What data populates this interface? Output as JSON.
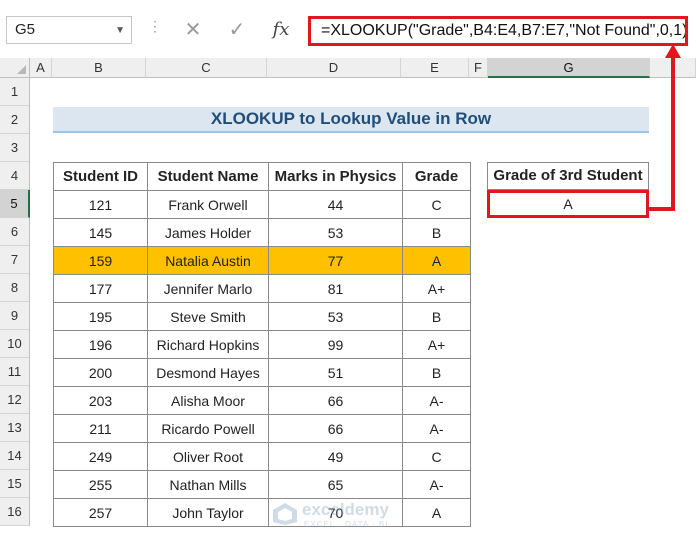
{
  "name_box": {
    "value": "G5"
  },
  "formula_bar": {
    "separator": "⋮",
    "cancel_symbol": "✕",
    "enter_symbol": "✓",
    "fx_label": "fx",
    "formula": "=XLOOKUP(\"Grade\",B4:E4,B7:E7,\"Not Found\",0,1)"
  },
  "columns": [
    "A",
    "B",
    "C",
    "D",
    "E",
    "F",
    "G"
  ],
  "selected_column": "G",
  "rows": [
    "1",
    "2",
    "3",
    "4",
    "5",
    "6",
    "7",
    "8",
    "9",
    "10",
    "11",
    "12",
    "13",
    "14",
    "15",
    "16"
  ],
  "selected_row": "5",
  "title": "XLOOKUP to Lookup Value in Row",
  "table": {
    "headers": [
      "Student ID",
      "Student Name",
      "Marks in Physics",
      "Grade"
    ],
    "highlight_row_index": 2,
    "rows": [
      [
        "121",
        "Frank Orwell",
        "44",
        "C"
      ],
      [
        "145",
        "James Holder",
        "53",
        "B"
      ],
      [
        "159",
        "Natalia Austin",
        "77",
        "A"
      ],
      [
        "177",
        "Jennifer Marlo",
        "81",
        "A+"
      ],
      [
        "195",
        "Steve Smith",
        "53",
        "B"
      ],
      [
        "196",
        "Richard Hopkins",
        "99",
        "A+"
      ],
      [
        "200",
        "Desmond Hayes",
        "51",
        "B"
      ],
      [
        "203",
        "Alisha Moor",
        "66",
        "A-"
      ],
      [
        "211",
        "Ricardo Powell",
        "66",
        "A-"
      ],
      [
        "249",
        "Oliver Root",
        "49",
        "C"
      ],
      [
        "255",
        "Nathan Mills",
        "65",
        "A-"
      ],
      [
        "257",
        "John Taylor",
        "70",
        "A"
      ]
    ]
  },
  "result": {
    "header": "Grade of 3rd Student",
    "value": "A"
  },
  "watermark": {
    "name": "exceldemy",
    "tagline": "EXCEL · DATA · BI"
  },
  "colors": {
    "highlight": "#ffc000",
    "callout": "#e3151d",
    "title_bg": "#dce6f1",
    "title_text": "#1f4e79",
    "excel_green": "#217346"
  }
}
